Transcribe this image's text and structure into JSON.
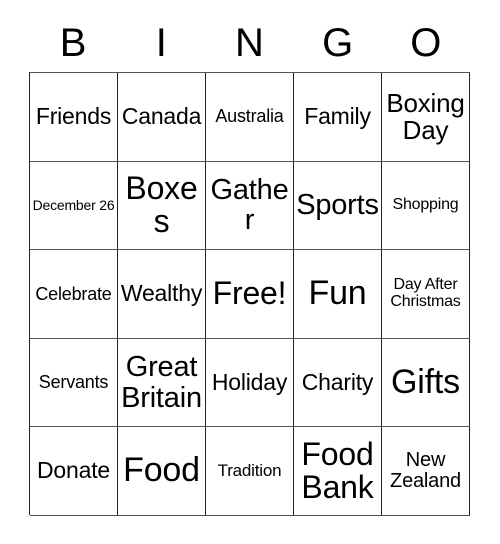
{
  "header": {
    "letters": [
      "B",
      "I",
      "N",
      "G",
      "O"
    ]
  },
  "grid": {
    "rows": [
      [
        {
          "text": "Friends",
          "size": "fs-lg"
        },
        {
          "text": "Canada",
          "size": "fs-lg"
        },
        {
          "text": "Australia",
          "size": "fs-md"
        },
        {
          "text": "Family",
          "size": "fs-lg"
        },
        {
          "text": "Boxing Day",
          "size": "fs-lgp"
        }
      ],
      [
        {
          "text": "December 26",
          "size": "fs-xs"
        },
        {
          "text": "Boxes",
          "size": "fs-xxl"
        },
        {
          "text": "Gather",
          "size": "fs-xl"
        },
        {
          "text": "Sports",
          "size": "fs-xl"
        },
        {
          "text": "Shopping",
          "size": "fs-sm"
        }
      ],
      [
        {
          "text": "Celebrate",
          "size": "fs-md"
        },
        {
          "text": "Wealthy",
          "size": "fs-lg"
        },
        {
          "text": "Free!",
          "size": "fs-xxl"
        },
        {
          "text": "Fun",
          "size": "fs-huge"
        },
        {
          "text": "Day After Christmas",
          "size": "fs-sm"
        }
      ],
      [
        {
          "text": "Servants",
          "size": "fs-md"
        },
        {
          "text": "Great Britain",
          "size": "fs-xl"
        },
        {
          "text": "Holiday",
          "size": "fs-lg"
        },
        {
          "text": "Charity",
          "size": "fs-lg"
        },
        {
          "text": "Gifts",
          "size": "fs-huge"
        }
      ],
      [
        {
          "text": "Donate",
          "size": "fs-lg"
        },
        {
          "text": "Food",
          "size": "fs-huge"
        },
        {
          "text": "Tradition",
          "size": "fs-smp"
        },
        {
          "text": "Food Bank",
          "size": "fs-xxl"
        },
        {
          "text": "New Zealand",
          "size": "fs-mdl"
        }
      ]
    ]
  }
}
